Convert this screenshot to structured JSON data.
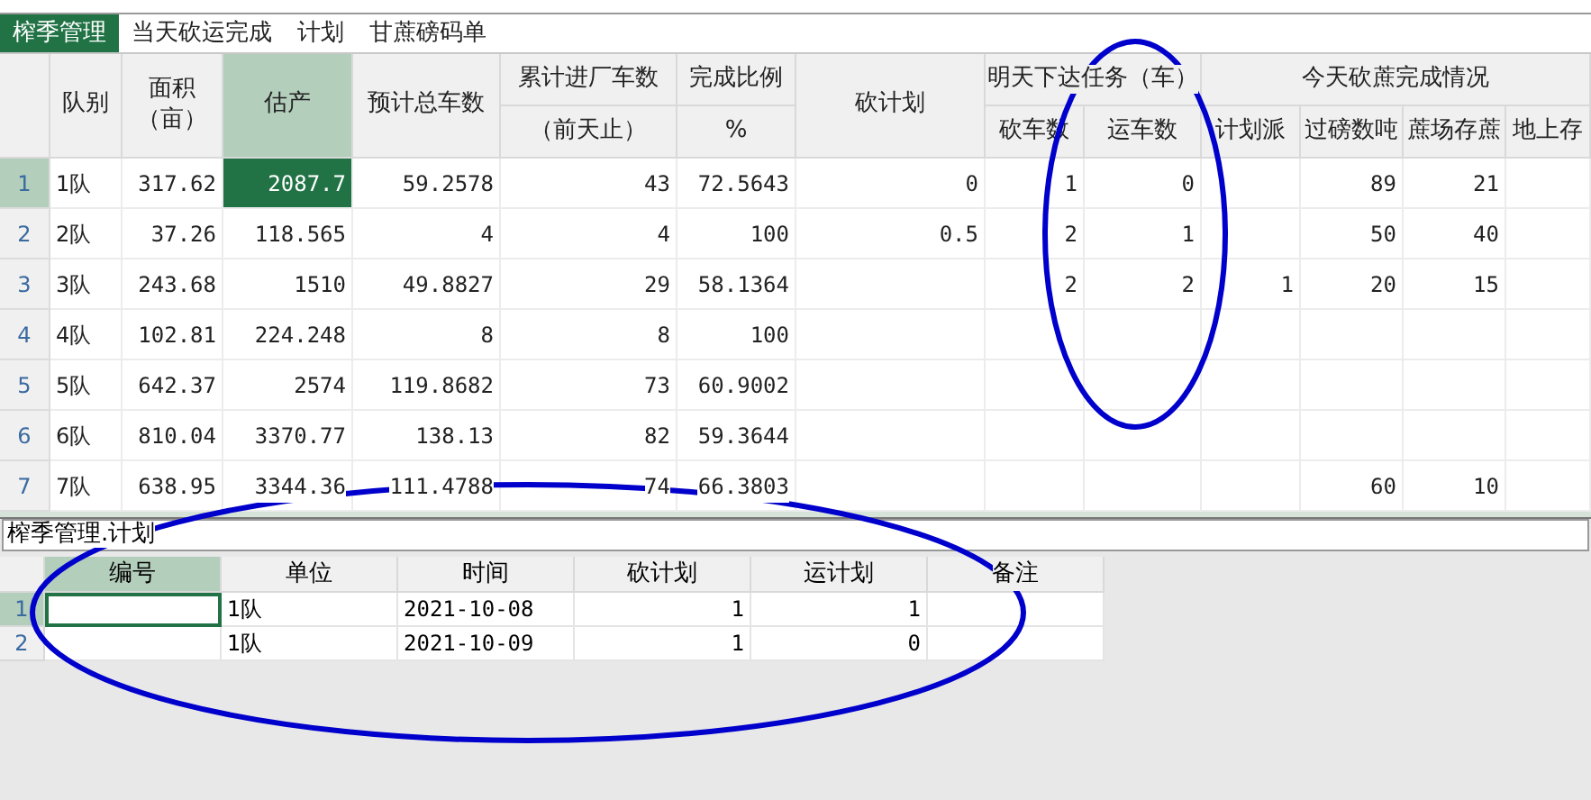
{
  "tabs": [
    {
      "label": "榨季管理",
      "selected": true
    },
    {
      "label": "当天砍运完成",
      "selected": false
    },
    {
      "label": "计划",
      "selected": false
    },
    {
      "label": "甘蔗磅码单",
      "selected": false
    }
  ],
  "top_table": {
    "columns": [
      {
        "kind": "single",
        "label": [
          "队别"
        ],
        "selected": false
      },
      {
        "kind": "single",
        "label": [
          "面积",
          "（亩）"
        ],
        "selected": false
      },
      {
        "kind": "single",
        "label": [
          "估产"
        ],
        "selected": true
      },
      {
        "kind": "single",
        "label": [
          "预计总车数"
        ],
        "selected": false
      },
      {
        "kind": "stacked",
        "label": [
          "累计进厂车数"
        ],
        "sub_label": "（前天止）",
        "selected": false
      },
      {
        "kind": "stacked",
        "label": [
          "完成比例"
        ],
        "sub_label": "%",
        "selected": false
      },
      {
        "kind": "single",
        "label": [
          "砍计划"
        ],
        "selected": false
      },
      {
        "kind": "grouped",
        "group_label": "明天下达任务（车）",
        "label": [
          "砍车数"
        ],
        "selected": false
      },
      {
        "kind": "grouped",
        "label": [
          "运车数"
        ],
        "selected": false
      },
      {
        "kind": "grouped",
        "group_label": "今天砍蔗完成情况",
        "label": [
          "计划派"
        ],
        "selected": false
      },
      {
        "kind": "grouped",
        "label": [
          "过磅数吨"
        ],
        "selected": false
      },
      {
        "kind": "grouped",
        "label": [
          "蔗场存蔗"
        ],
        "selected": false
      },
      {
        "kind": "grouped",
        "label": [
          "地上存"
        ],
        "selected": false
      }
    ],
    "rows": [
      {
        "number": "1",
        "selected": true,
        "cells": [
          "1队",
          "317.62",
          "2087.7",
          "59.2578",
          "43",
          "72.5643",
          "0",
          "1",
          "0",
          null,
          "89",
          "21",
          null
        ]
      },
      {
        "number": "2",
        "selected": false,
        "cells": [
          "2队",
          "37.26",
          "118.565",
          "4",
          "4",
          "100",
          "0.5",
          "2",
          "1",
          null,
          "50",
          "40",
          null
        ]
      },
      {
        "number": "3",
        "selected": false,
        "cells": [
          "3队",
          "243.68",
          "1510",
          "49.8827",
          "29",
          "58.1364",
          null,
          "2",
          "2",
          "1",
          "20",
          "15",
          null
        ]
      },
      {
        "number": "4",
        "selected": false,
        "cells": [
          "4队",
          "102.81",
          "224.248",
          "8",
          "8",
          "100",
          null,
          null,
          null,
          null,
          null,
          null,
          null
        ]
      },
      {
        "number": "5",
        "selected": false,
        "cells": [
          "5队",
          "642.37",
          "2574",
          "119.8682",
          "73",
          "60.9002",
          null,
          null,
          null,
          null,
          null,
          null,
          null
        ]
      },
      {
        "number": "6",
        "selected": false,
        "cells": [
          "6队",
          "810.04",
          "3370.77",
          "138.13",
          "82",
          "59.3644",
          null,
          null,
          null,
          null,
          null,
          null,
          null
        ]
      },
      {
        "number": "7",
        "selected": false,
        "cells": [
          "7队",
          "638.95",
          "3344.36",
          "111.4788",
          "74",
          "66.3803",
          null,
          null,
          null,
          null,
          "60",
          "10",
          null
        ]
      }
    ]
  },
  "bottom_panel": {
    "title": "榨季管理.计划",
    "columns": [
      {
        "label": "编号",
        "selected": true
      },
      {
        "label": "单位",
        "selected": false
      },
      {
        "label": "时间",
        "selected": false
      },
      {
        "label": "砍计划",
        "selected": false
      },
      {
        "label": "运计划",
        "selected": false
      },
      {
        "label": "备注",
        "selected": false
      }
    ],
    "rows": [
      {
        "number": "1",
        "selected": true,
        "cells": [
          null,
          "1队",
          "2021-10-08",
          "1",
          "1",
          null
        ]
      },
      {
        "number": "2",
        "selected": false,
        "cells": [
          null,
          "1队",
          "2021-10-09",
          "1",
          "0",
          null
        ]
      }
    ]
  }
}
